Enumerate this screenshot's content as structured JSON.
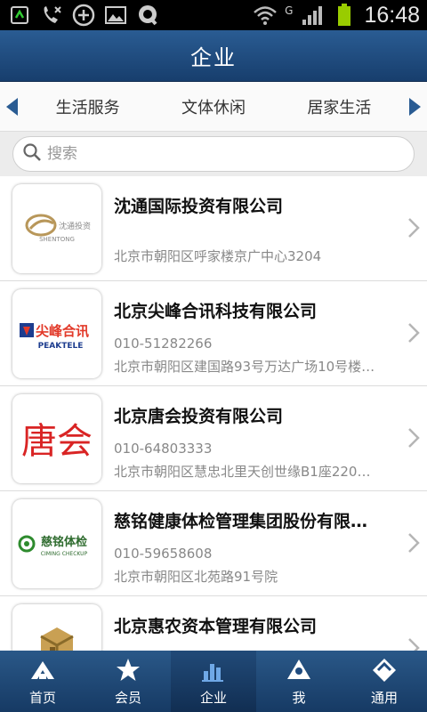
{
  "status_bar": {
    "time": "16:48",
    "network": "G",
    "icons": [
      "usb-debug-icon",
      "missed-call-icon",
      "add-circle-icon",
      "image-icon",
      "app-q-icon",
      "wifi-icon",
      "signal-icon",
      "battery-icon"
    ]
  },
  "header": {
    "title": "企业"
  },
  "categories": {
    "items": [
      "生活服务",
      "文体休闲",
      "居家生活"
    ],
    "left_icon": "triangle-left-icon",
    "right_icon": "triangle-right-icon",
    "arrow_color": "#2a5c93"
  },
  "search": {
    "placeholder": "搜索",
    "value": ""
  },
  "companies": [
    {
      "name": "沈通国际投资有限公司",
      "phone": "",
      "address": "北京市朝阳区呼家楼京广中心3204",
      "logo_text": "沈通投资",
      "logo_subtext": "SHENTONG"
    },
    {
      "name": "北京尖峰合讯科技有限公司",
      "phone": "010-51282266",
      "address": "北京市朝阳区建国路93号万达广场10号楼…",
      "logo_text": "尖峰合讯",
      "logo_subtext": "PEAKTELE"
    },
    {
      "name": "北京唐会投资有限公司",
      "phone": "010-64803333",
      "address": "北京市朝阳区慧忠北里天创世缘B1座220…",
      "logo_text": "唐会",
      "logo_subtext": ""
    },
    {
      "name": "慈铭健康体检管理集团股份有限…",
      "phone": "010-59658608",
      "address": "北京市朝阳区北苑路91号院",
      "logo_text": "慈铭体检",
      "logo_subtext": "CIMING CHECKUP"
    },
    {
      "name": "北京惠农资本管理有限公司",
      "phone": "",
      "address": "",
      "logo_text": "",
      "logo_subtext": ""
    }
  ],
  "tabs": [
    {
      "label": "首页",
      "icon": "home-icon",
      "active": false
    },
    {
      "label": "会员",
      "icon": "star-icon",
      "active": false
    },
    {
      "label": "企业",
      "icon": "bar-chart-icon",
      "active": true
    },
    {
      "label": "我",
      "icon": "user-icon",
      "active": false
    },
    {
      "label": "通用",
      "icon": "diamond-icon",
      "active": false
    }
  ],
  "colors": {
    "header": "#1f4b7f",
    "tabbar": "#1f4b7f",
    "accent": "#2a5c93"
  }
}
